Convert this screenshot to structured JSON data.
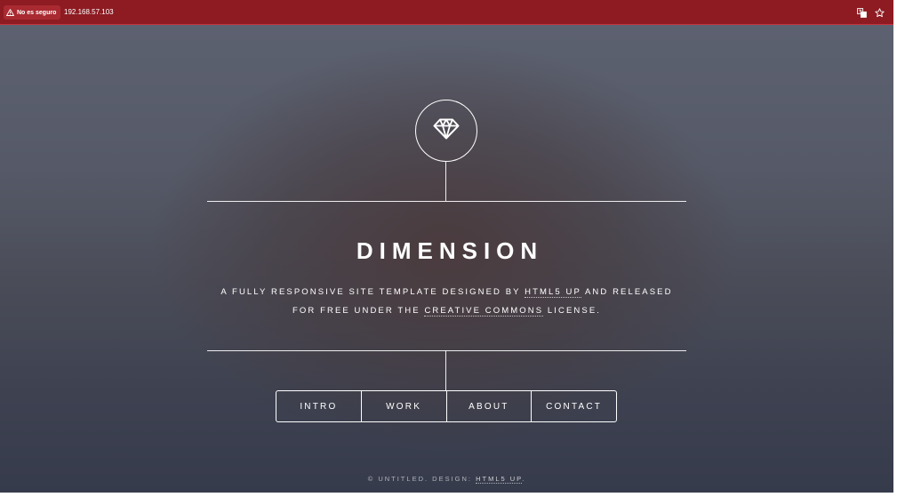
{
  "browser": {
    "security_label": "No es seguro",
    "url": "192.168.57.103",
    "icons": {
      "warning": "warning-triangle-icon",
      "translate": "translate-icon",
      "bookmark": "star-icon"
    },
    "colors": {
      "insecure_bar": "#8e1b22"
    }
  },
  "header": {
    "logo_icon": "diamond-icon",
    "title": "DIMENSION",
    "tagline": {
      "part1": "A FULLY RESPONSIVE SITE TEMPLATE DESIGNED BY ",
      "link1": "HTML5 UP",
      "part2": " AND RELEASED FOR FREE UNDER THE ",
      "link2": "CREATIVE COMMONS",
      "part3": " LICENSE."
    }
  },
  "nav": {
    "items": [
      {
        "label": "INTRO"
      },
      {
        "label": "WORK"
      },
      {
        "label": "ABOUT"
      },
      {
        "label": "CONTACT"
      }
    ]
  },
  "footer": {
    "prefix": "© UNTITLED. DESIGN: ",
    "link": "HTML5 UP",
    "suffix": "."
  }
}
